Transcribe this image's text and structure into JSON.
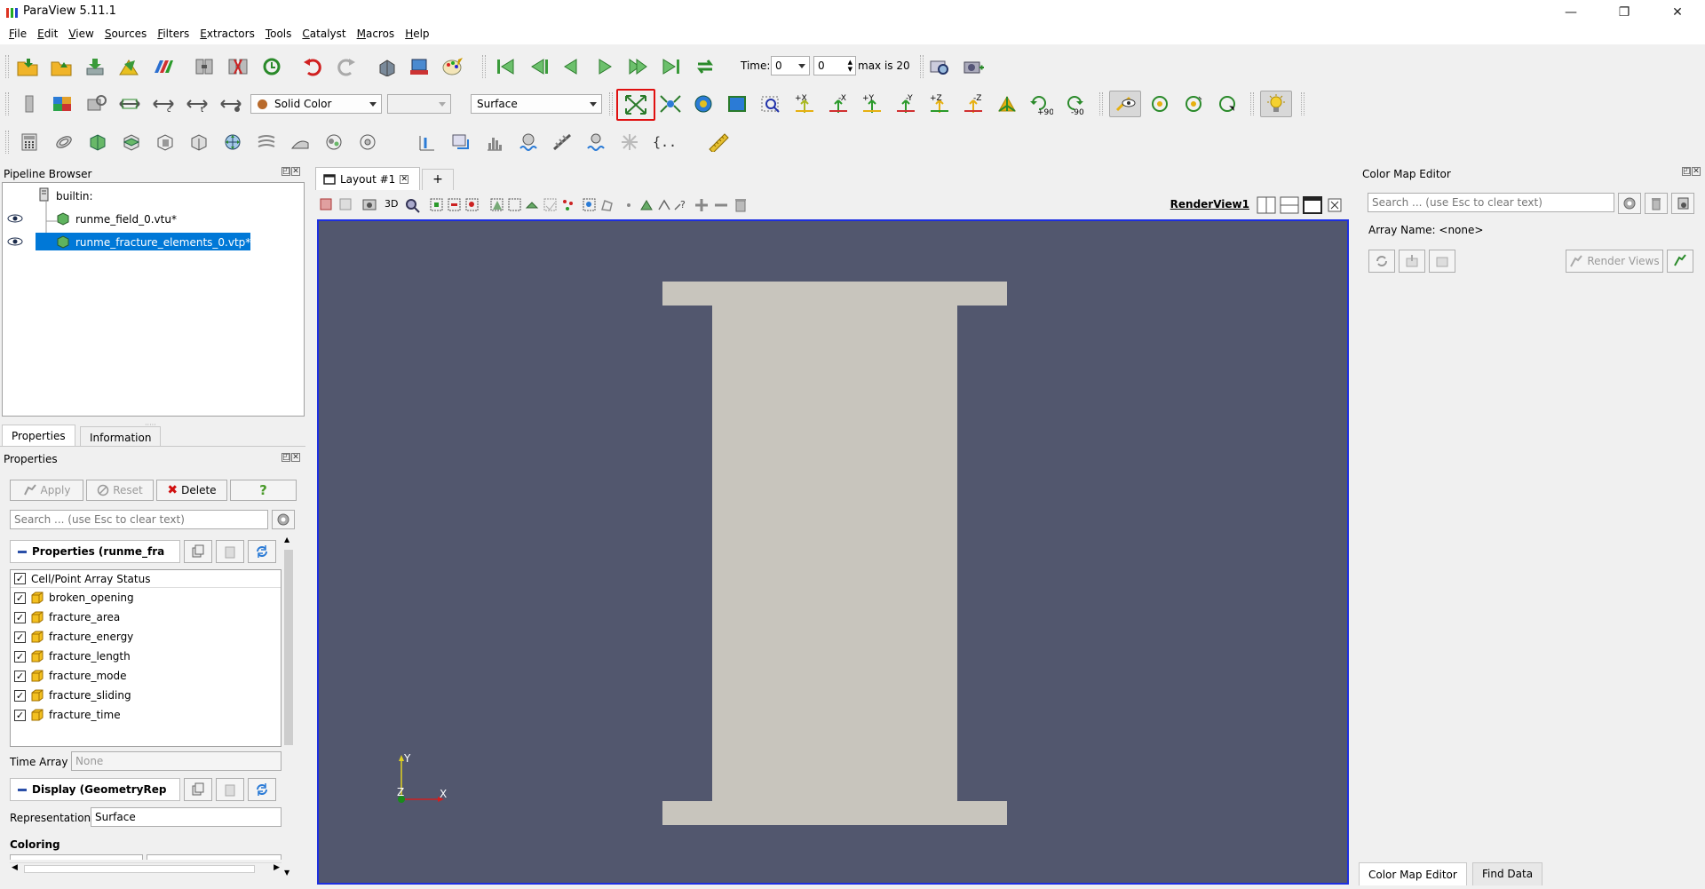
{
  "window": {
    "title": "ParaView 5.11.1",
    "minimize": "—",
    "maximize": "❐",
    "close": "✕"
  },
  "menu": [
    {
      "label": "File",
      "u": "F",
      "rest": "ile"
    },
    {
      "label": "Edit",
      "u": "E",
      "rest": "dit"
    },
    {
      "label": "View",
      "u": "V",
      "rest": "iew"
    },
    {
      "label": "Sources",
      "u": "S",
      "rest": "ources"
    },
    {
      "label": "Filters",
      "u": "F",
      "rest": "ilters"
    },
    {
      "label": "Extractors",
      "u": "E",
      "rest": "xtractors"
    },
    {
      "label": "Tools",
      "u": "T",
      "rest": "ools"
    },
    {
      "label": "Catalyst",
      "u": "C",
      "rest": "atalyst"
    },
    {
      "label": "Macros",
      "u": "M",
      "rest": "acros"
    },
    {
      "label": "Help",
      "u": "H",
      "rest": "elp"
    }
  ],
  "time_toolbar": {
    "time_label": "Time:",
    "time_value": "0",
    "index_value": "0",
    "max_text": "max is 20"
  },
  "display_toolbar": {
    "color_by": "Solid Color",
    "component": "",
    "representation": "Surface"
  },
  "camera_labels": {
    "px": "+X",
    "mx": "-X",
    "py": "+Y",
    "my": "-Y",
    "pz": "+Z",
    "mz": "-Z",
    "rot_pos": "+90",
    "rot_neg": "-90"
  },
  "pipeline": {
    "title": "Pipeline Browser",
    "root": "builtin:",
    "items": [
      {
        "label": "runme_field_0.vtu*",
        "selected": false
      },
      {
        "label": "runme_fracture_elements_0.vtp*",
        "selected": true
      }
    ]
  },
  "tabs": {
    "properties": "Properties",
    "information": "Information"
  },
  "properties": {
    "title": "Properties",
    "apply": "Apply",
    "reset": "Reset",
    "delete": "Delete",
    "help": "?",
    "search_placeholder": "Search ... (use Esc to clear text)",
    "section1": "Properties (runme_fra",
    "array_status_header": "Cell/Point Array Status",
    "arrays": [
      "broken_opening",
      "fracture_area",
      "fracture_energy",
      "fracture_length",
      "fracture_mode",
      "fracture_sliding",
      "fracture_time"
    ],
    "time_array_label": "Time Array",
    "time_array_value": "None",
    "section2": "Display (GeometryRep",
    "representation_label": "Representation",
    "representation_value": "Surface",
    "coloring_label": "Coloring"
  },
  "layout": {
    "tab": "Layout #1",
    "add": "+",
    "view_name": "RenderView1",
    "btn_3d": "3D"
  },
  "axes": {
    "x": "X",
    "y": "Y",
    "z": "Z"
  },
  "colormap": {
    "title": "Color Map Editor",
    "search_placeholder": "Search ... (use Esc to clear text)",
    "array_name_label": "Array Name: <none>",
    "render_views": "Render Views"
  },
  "bottom_tabs": {
    "colormap": "Color Map Editor",
    "find": "Find Data"
  },
  "colors": {
    "background": "#52576e",
    "object": "#c8c5bd",
    "selection": "#0078d7",
    "highlight": "#e01010"
  }
}
